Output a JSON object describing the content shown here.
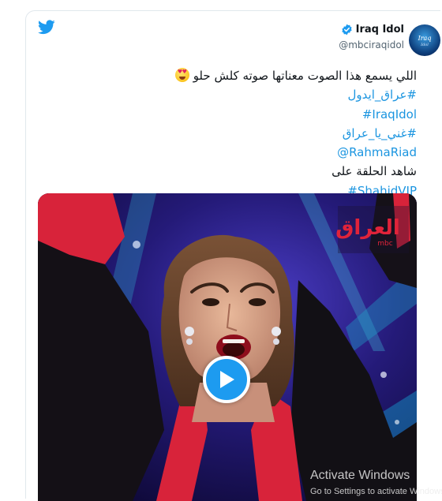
{
  "account": {
    "display_name": "Iraq Idol",
    "handle": "@mbciraqidol",
    "avatar_text": "Iraq",
    "avatar_subtext": "Idol"
  },
  "tweet": {
    "line1": "اللي يسمع هذا الصوت معناتها صوته كلش حلو",
    "hashtag1": "#عراق_ايدول",
    "hashtag2": "#IraqIdol",
    "hashtag3": "#غني_يا_عراق",
    "mention": "@RahmaRiad",
    "line6": "شاهد الحلقة على",
    "hashtag4": "#ShahidVIP"
  },
  "media": {
    "channel_logo": "العراق",
    "channel_logo_sub": "mbc"
  },
  "watermark": {
    "title": "Activate Windows",
    "subtitle": "Go to Settings to activate Windows."
  },
  "colors": {
    "link": "#1b95e0",
    "twitter_blue": "#1d9bf0",
    "text": "#0f1419",
    "muted": "#536471"
  },
  "icons": [
    "twitter-bird-icon",
    "verified-badge-icon",
    "heart-eyes-emoji-icon",
    "play-icon"
  ]
}
